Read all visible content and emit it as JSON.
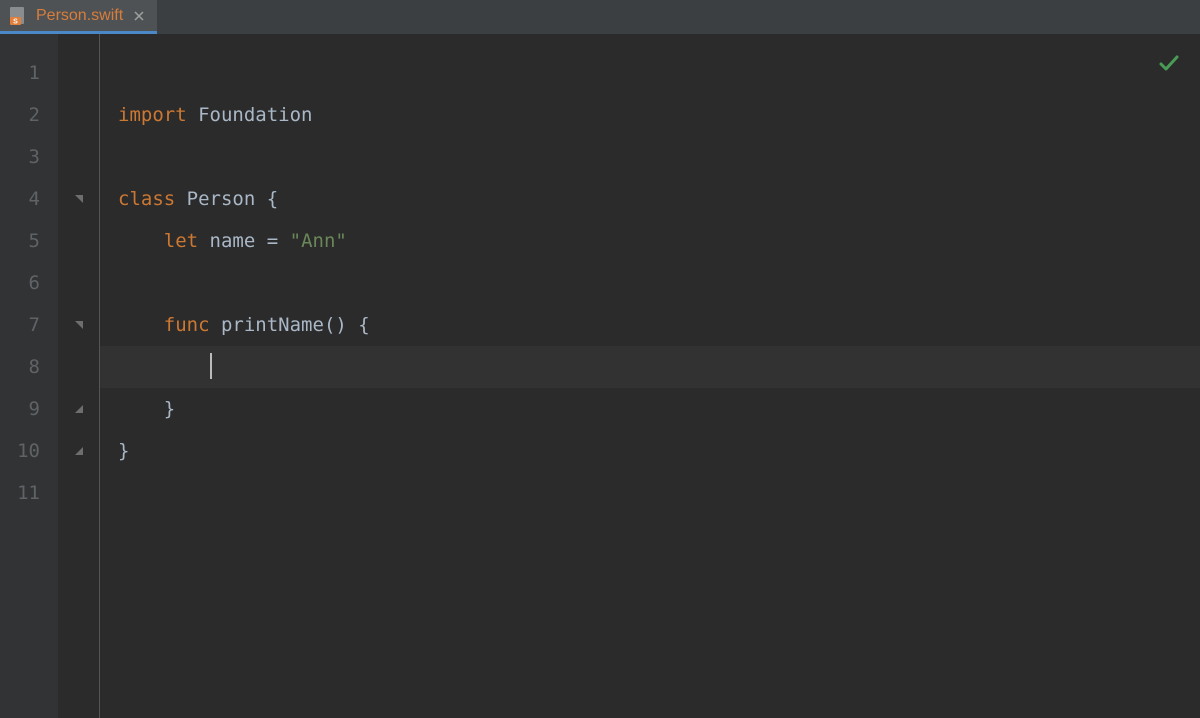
{
  "tab": {
    "filename": "Person.swift",
    "active": true
  },
  "gutter": {
    "lines": [
      "1",
      "2",
      "3",
      "4",
      "5",
      "6",
      "7",
      "8",
      "9",
      "10",
      "11"
    ]
  },
  "code": {
    "line2": {
      "kw": "import",
      "sp": " ",
      "ident": "Foundation"
    },
    "line4": {
      "kw": "class",
      "sp": " ",
      "type": "Person",
      "rest": " {"
    },
    "line5": {
      "indent": "    ",
      "kw": "let",
      "sp": " ",
      "ident": "name",
      "eq": " = ",
      "str": "\"Ann\""
    },
    "line7": {
      "indent": "    ",
      "kw": "func",
      "sp": " ",
      "ident": "printName",
      "rest": "() {"
    },
    "line8": {
      "indent": "        "
    },
    "line9": {
      "indent": "    ",
      "brace": "}"
    },
    "line10": {
      "brace": "}"
    }
  },
  "status": {
    "ok": true
  }
}
